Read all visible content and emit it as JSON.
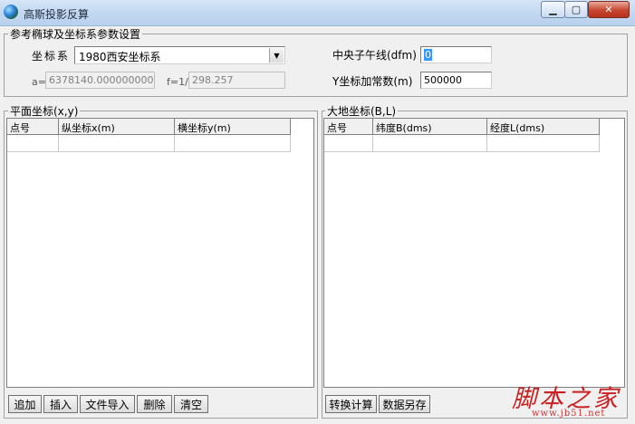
{
  "window": {
    "title": "高斯投影反算",
    "minimize": "▁",
    "maximize": "▢",
    "close": "✕"
  },
  "params": {
    "group_title": "参考椭球及坐标系参数设置",
    "coord_label": "坐标系",
    "coord_value": "1980西安坐标系",
    "a_label": "a=",
    "a_value": "6378140.0000000000",
    "f_label": "f=1/",
    "f_value": "298.257",
    "meridian_label": "中央子午线(dfm)",
    "meridian_value": "0",
    "yconst_label": "Y坐标加常数(m)",
    "yconst_value": "500000"
  },
  "plane": {
    "group_title": "平面坐标(x,y)",
    "columns": [
      "点号",
      "纵坐标x(m)",
      "横坐标y(m)"
    ],
    "buttons": {
      "add": "追加",
      "insert": "插入",
      "import": "文件导入",
      "delete": "删除",
      "clear": "清空"
    }
  },
  "geo": {
    "group_title": "大地坐标(B,L)",
    "columns": [
      "点号",
      "纬度B(dms)",
      "经度L(dms)"
    ],
    "buttons": {
      "compute": "转换计算",
      "save": "数据另存"
    }
  },
  "watermark": {
    "main": "脚本之家",
    "sub": "www.jb51.net"
  }
}
